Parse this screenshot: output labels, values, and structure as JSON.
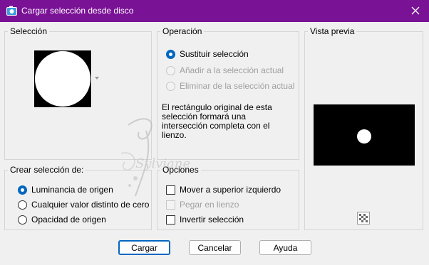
{
  "window": {
    "title": "Cargar selección desde disco",
    "title_bar_color": "#7a1296"
  },
  "seleccion": {
    "label": "Selección"
  },
  "operacion": {
    "label": "Operación",
    "options": [
      {
        "label": "Sustituir selección",
        "checked": true,
        "enabled": true
      },
      {
        "label": "Añadir a la selección actual",
        "checked": false,
        "enabled": false
      },
      {
        "label": "Eliminar de la selección actual",
        "checked": false,
        "enabled": false
      }
    ],
    "info_text": "El rectángulo original de esta selección formará una intersección completa con el lienzo."
  },
  "vista_previa": {
    "label": "Vista previa"
  },
  "crear": {
    "label": "Crear selección de:",
    "options": [
      {
        "label": "Luminancia de origen",
        "checked": true
      },
      {
        "label": "Cualquier valor distinto de cero",
        "checked": false
      },
      {
        "label": "Opacidad de origen",
        "checked": false
      }
    ]
  },
  "opciones": {
    "label": "Opciones",
    "items": [
      {
        "label": "Mover a superior izquierdo",
        "checked": false,
        "enabled": true
      },
      {
        "label": "Pegar en lienzo",
        "checked": false,
        "enabled": false
      },
      {
        "label": "Invertir selección",
        "checked": false,
        "enabled": true
      }
    ]
  },
  "buttons": {
    "cargar": "Cargar",
    "cancelar": "Cancelar",
    "ayuda": "Ayuda"
  },
  "watermark": {
    "text": "Sylviane"
  },
  "colors": {
    "accent": "#0067c0",
    "disabled_text": "#a0a0a0"
  }
}
